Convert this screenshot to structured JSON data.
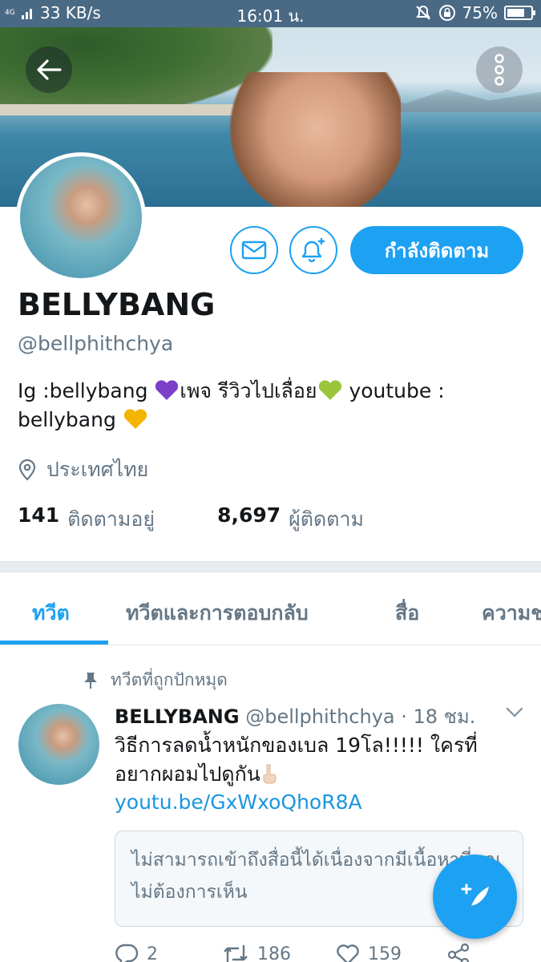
{
  "status_bar": {
    "network_label": "4G",
    "speed": "33 KB/s",
    "time": "16:01 น.",
    "battery": "75%",
    "battery_level": 0.75
  },
  "profile": {
    "name": "BELLYBANG",
    "handle": "@bellphithchya",
    "bio_part1": "Ig :bellybang ",
    "bio_part2": "เพจ รีวิวไปเลื่อย",
    "bio_part3": " youtube : bellybang ",
    "location": "ประเทศไทย",
    "following_count": "141",
    "following_label": "ติดตามอยู่",
    "followers_count": "8,697",
    "followers_label": "ผู้ติดตาม",
    "follow_button": "กำลังติดตาม"
  },
  "tabs": [
    {
      "label": "ทวีต",
      "active": true
    },
    {
      "label": "ทวีตและการตอบกลับ",
      "active": false
    },
    {
      "label": "สื่อ",
      "active": false
    },
    {
      "label": "ความชอบ",
      "active": false
    }
  ],
  "tweet": {
    "pinned_label": "ทวีตที่ถูกปักหมุด",
    "author_name": "BELLYBANG",
    "author_handle": "@bellphithchya",
    "time": "· 18 ชม.",
    "text": "วิธีการลดน้ำหนักของเบล 19โล!!!!! ใครที่อยากผอมไปดูกัน",
    "link": "youtu.be/GxWxoQhoR8A",
    "sensitive_notice": "ไม่สามารถเข้าถึงสื่อนี้ได้เนื่องจากมีเนื้อหาที่คุณไม่ต้องการเห็น",
    "replies": "2",
    "retweets": "186",
    "likes": "159"
  },
  "colors": {
    "accent": "#1da1f2",
    "status_bar": "#4a6984",
    "heart_purple": "#7c3fc7",
    "heart_green": "#9bc53d",
    "heart_yellow": "#f5b400"
  },
  "icons": [
    "back-arrow-icon",
    "more-vertical-icon",
    "mail-icon",
    "bell-plus-icon",
    "location-pin-icon",
    "pin-icon",
    "chevron-down-icon",
    "reply-icon",
    "retweet-icon",
    "like-icon",
    "share-icon",
    "compose-icon"
  ]
}
